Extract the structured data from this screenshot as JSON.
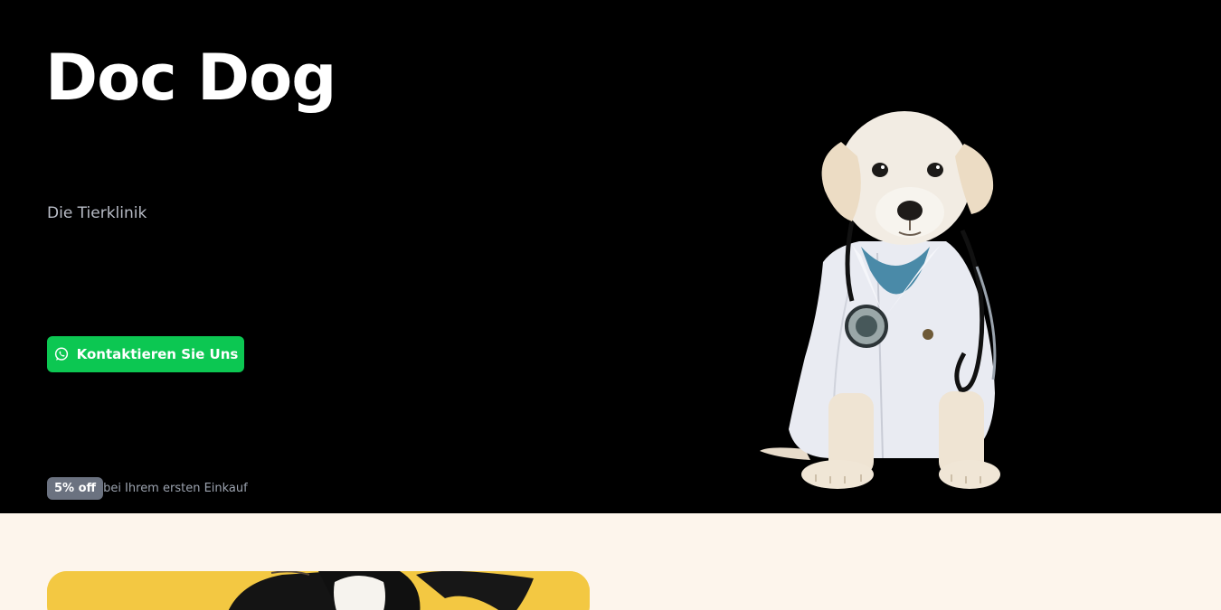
{
  "hero": {
    "title": "Doc Dog",
    "subtitle": "Die Tierklinik",
    "cta_label": "Kontaktieren Sie Uns",
    "cta_icon": "whatsapp-icon",
    "promo": {
      "badge": "5% off",
      "text": "bei Ihrem ersten Einkauf"
    },
    "image": "puppy-doctor-with-stethoscope"
  },
  "colors": {
    "hero_bg": "#000000",
    "cta_green": "#0cc752",
    "badge_gray": "#6b7280",
    "section_bg": "#fdf5ec",
    "card_yellow": "#f3c842"
  },
  "section": {
    "image": "border-collie-photo"
  }
}
